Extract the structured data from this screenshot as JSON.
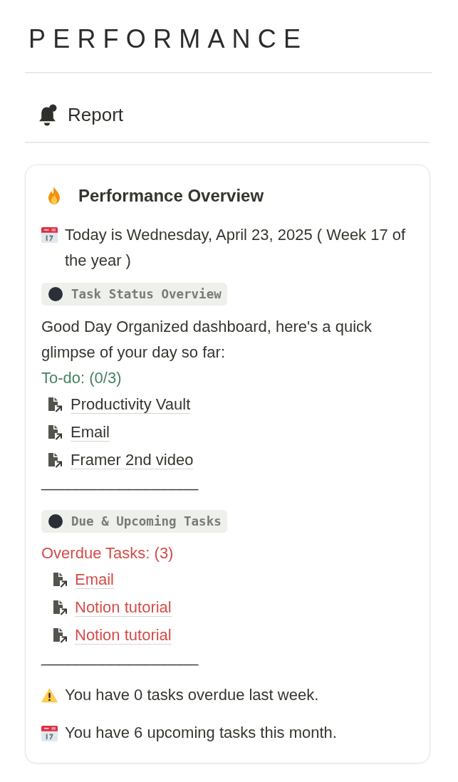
{
  "page_title": "PERFORMANCE",
  "section": {
    "title": "Report"
  },
  "card": {
    "title": "Performance Overview",
    "date_line": "Today is Wednesday, April 23, 2025 ( Week 17 of the year )",
    "groups": [
      {
        "kind": "todo",
        "label": "Task Status Overview",
        "intro": "Good Day Organized dashboard, here's a quick glimpse of your day so far:",
        "heading": "To-do: (0/3)",
        "items": [
          "Productivity Vault",
          "Email",
          "Framer 2nd video"
        ],
        "rule": "__________________"
      },
      {
        "kind": "overdue",
        "label": "Due & Upcoming Tasks",
        "heading": "Overdue Tasks: (3)",
        "items": [
          "Email",
          "Notion tutorial",
          "Notion tutorial"
        ],
        "rule": "__________________"
      }
    ],
    "notes": [
      {
        "kind": "warning",
        "text": "You have 0 tasks overdue last week."
      },
      {
        "kind": "calendar",
        "text": "You have 6 upcoming tasks this month."
      }
    ]
  }
}
